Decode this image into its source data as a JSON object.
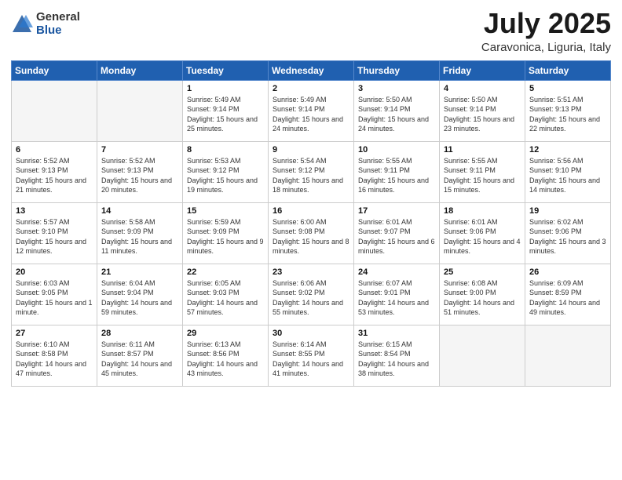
{
  "header": {
    "logo_general": "General",
    "logo_blue": "Blue",
    "title": "July 2025",
    "subtitle": "Caravonica, Liguria, Italy"
  },
  "weekdays": [
    "Sunday",
    "Monday",
    "Tuesday",
    "Wednesday",
    "Thursday",
    "Friday",
    "Saturday"
  ],
  "weeks": [
    [
      {
        "day": "",
        "detail": ""
      },
      {
        "day": "",
        "detail": ""
      },
      {
        "day": "1",
        "detail": "Sunrise: 5:49 AM\nSunset: 9:14 PM\nDaylight: 15 hours\nand 25 minutes."
      },
      {
        "day": "2",
        "detail": "Sunrise: 5:49 AM\nSunset: 9:14 PM\nDaylight: 15 hours\nand 24 minutes."
      },
      {
        "day": "3",
        "detail": "Sunrise: 5:50 AM\nSunset: 9:14 PM\nDaylight: 15 hours\nand 24 minutes."
      },
      {
        "day": "4",
        "detail": "Sunrise: 5:50 AM\nSunset: 9:14 PM\nDaylight: 15 hours\nand 23 minutes."
      },
      {
        "day": "5",
        "detail": "Sunrise: 5:51 AM\nSunset: 9:13 PM\nDaylight: 15 hours\nand 22 minutes."
      }
    ],
    [
      {
        "day": "6",
        "detail": "Sunrise: 5:52 AM\nSunset: 9:13 PM\nDaylight: 15 hours\nand 21 minutes."
      },
      {
        "day": "7",
        "detail": "Sunrise: 5:52 AM\nSunset: 9:13 PM\nDaylight: 15 hours\nand 20 minutes."
      },
      {
        "day": "8",
        "detail": "Sunrise: 5:53 AM\nSunset: 9:12 PM\nDaylight: 15 hours\nand 19 minutes."
      },
      {
        "day": "9",
        "detail": "Sunrise: 5:54 AM\nSunset: 9:12 PM\nDaylight: 15 hours\nand 18 minutes."
      },
      {
        "day": "10",
        "detail": "Sunrise: 5:55 AM\nSunset: 9:11 PM\nDaylight: 15 hours\nand 16 minutes."
      },
      {
        "day": "11",
        "detail": "Sunrise: 5:55 AM\nSunset: 9:11 PM\nDaylight: 15 hours\nand 15 minutes."
      },
      {
        "day": "12",
        "detail": "Sunrise: 5:56 AM\nSunset: 9:10 PM\nDaylight: 15 hours\nand 14 minutes."
      }
    ],
    [
      {
        "day": "13",
        "detail": "Sunrise: 5:57 AM\nSunset: 9:10 PM\nDaylight: 15 hours\nand 12 minutes."
      },
      {
        "day": "14",
        "detail": "Sunrise: 5:58 AM\nSunset: 9:09 PM\nDaylight: 15 hours\nand 11 minutes."
      },
      {
        "day": "15",
        "detail": "Sunrise: 5:59 AM\nSunset: 9:09 PM\nDaylight: 15 hours\nand 9 minutes."
      },
      {
        "day": "16",
        "detail": "Sunrise: 6:00 AM\nSunset: 9:08 PM\nDaylight: 15 hours\nand 8 minutes."
      },
      {
        "day": "17",
        "detail": "Sunrise: 6:01 AM\nSunset: 9:07 PM\nDaylight: 15 hours\nand 6 minutes."
      },
      {
        "day": "18",
        "detail": "Sunrise: 6:01 AM\nSunset: 9:06 PM\nDaylight: 15 hours\nand 4 minutes."
      },
      {
        "day": "19",
        "detail": "Sunrise: 6:02 AM\nSunset: 9:06 PM\nDaylight: 15 hours\nand 3 minutes."
      }
    ],
    [
      {
        "day": "20",
        "detail": "Sunrise: 6:03 AM\nSunset: 9:05 PM\nDaylight: 15 hours\nand 1 minute."
      },
      {
        "day": "21",
        "detail": "Sunrise: 6:04 AM\nSunset: 9:04 PM\nDaylight: 14 hours\nand 59 minutes."
      },
      {
        "day": "22",
        "detail": "Sunrise: 6:05 AM\nSunset: 9:03 PM\nDaylight: 14 hours\nand 57 minutes."
      },
      {
        "day": "23",
        "detail": "Sunrise: 6:06 AM\nSunset: 9:02 PM\nDaylight: 14 hours\nand 55 minutes."
      },
      {
        "day": "24",
        "detail": "Sunrise: 6:07 AM\nSunset: 9:01 PM\nDaylight: 14 hours\nand 53 minutes."
      },
      {
        "day": "25",
        "detail": "Sunrise: 6:08 AM\nSunset: 9:00 PM\nDaylight: 14 hours\nand 51 minutes."
      },
      {
        "day": "26",
        "detail": "Sunrise: 6:09 AM\nSunset: 8:59 PM\nDaylight: 14 hours\nand 49 minutes."
      }
    ],
    [
      {
        "day": "27",
        "detail": "Sunrise: 6:10 AM\nSunset: 8:58 PM\nDaylight: 14 hours\nand 47 minutes."
      },
      {
        "day": "28",
        "detail": "Sunrise: 6:11 AM\nSunset: 8:57 PM\nDaylight: 14 hours\nand 45 minutes."
      },
      {
        "day": "29",
        "detail": "Sunrise: 6:13 AM\nSunset: 8:56 PM\nDaylight: 14 hours\nand 43 minutes."
      },
      {
        "day": "30",
        "detail": "Sunrise: 6:14 AM\nSunset: 8:55 PM\nDaylight: 14 hours\nand 41 minutes."
      },
      {
        "day": "31",
        "detail": "Sunrise: 6:15 AM\nSunset: 8:54 PM\nDaylight: 14 hours\nand 38 minutes."
      },
      {
        "day": "",
        "detail": ""
      },
      {
        "day": "",
        "detail": ""
      }
    ]
  ]
}
